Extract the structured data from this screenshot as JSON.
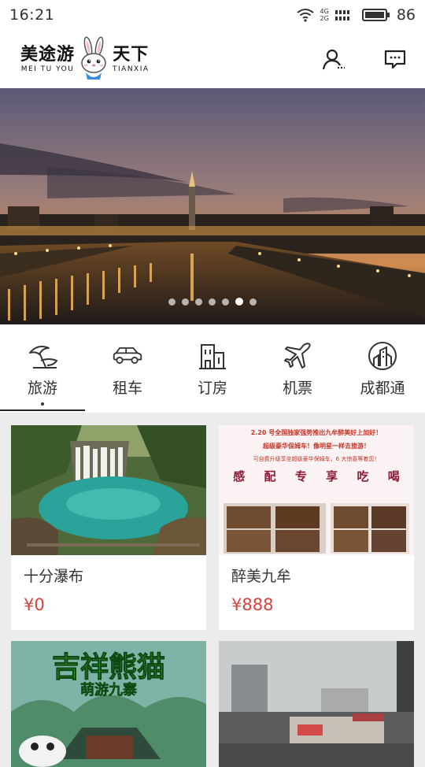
{
  "status": {
    "time": "16:21",
    "net_top": "4G",
    "net_bottom": "2G",
    "battery": "86"
  },
  "header": {
    "logo_cn_left": "美途游",
    "logo_cn_right": "天下",
    "logo_en_left": "MEI TU YOU",
    "logo_en_right": "TIANXIA",
    "icons": [
      "user-icon",
      "message-icon"
    ]
  },
  "banner": {
    "slide_count": 7,
    "active_index": 5
  },
  "categories": [
    {
      "label": "旅游",
      "icon": "beach-umbrella-icon",
      "selected": true
    },
    {
      "label": "租车",
      "icon": "car-icon",
      "selected": false
    },
    {
      "label": "订房",
      "icon": "building-icon",
      "selected": false
    },
    {
      "label": "机票",
      "icon": "airplane-icon",
      "selected": false
    },
    {
      "label": "成都通",
      "icon": "city-icon",
      "selected": false
    }
  ],
  "products": [
    {
      "title": "十分瀑布",
      "price": "¥0"
    },
    {
      "title": "醉美九牟",
      "price": "¥888",
      "poster": {
        "line1": "2.20 号全国独家强势推出九牟醉美好上加好！",
        "line2": "超级豪华保姆车！像明星一样去旅游！",
        "line3": "可自费升级享坐超级豪华保姆车，6 大惊喜等着您！",
        "big": [
          "感",
          "配",
          "专",
          "享",
          "吃",
          "喝"
        ]
      }
    },
    {
      "title": "",
      "price": "",
      "poster_text": [
        "吉祥熊猫",
        "萌游九寨"
      ]
    },
    {
      "title": "",
      "price": ""
    }
  ],
  "colors": {
    "price": "#d9413b",
    "accent": "#222222"
  }
}
